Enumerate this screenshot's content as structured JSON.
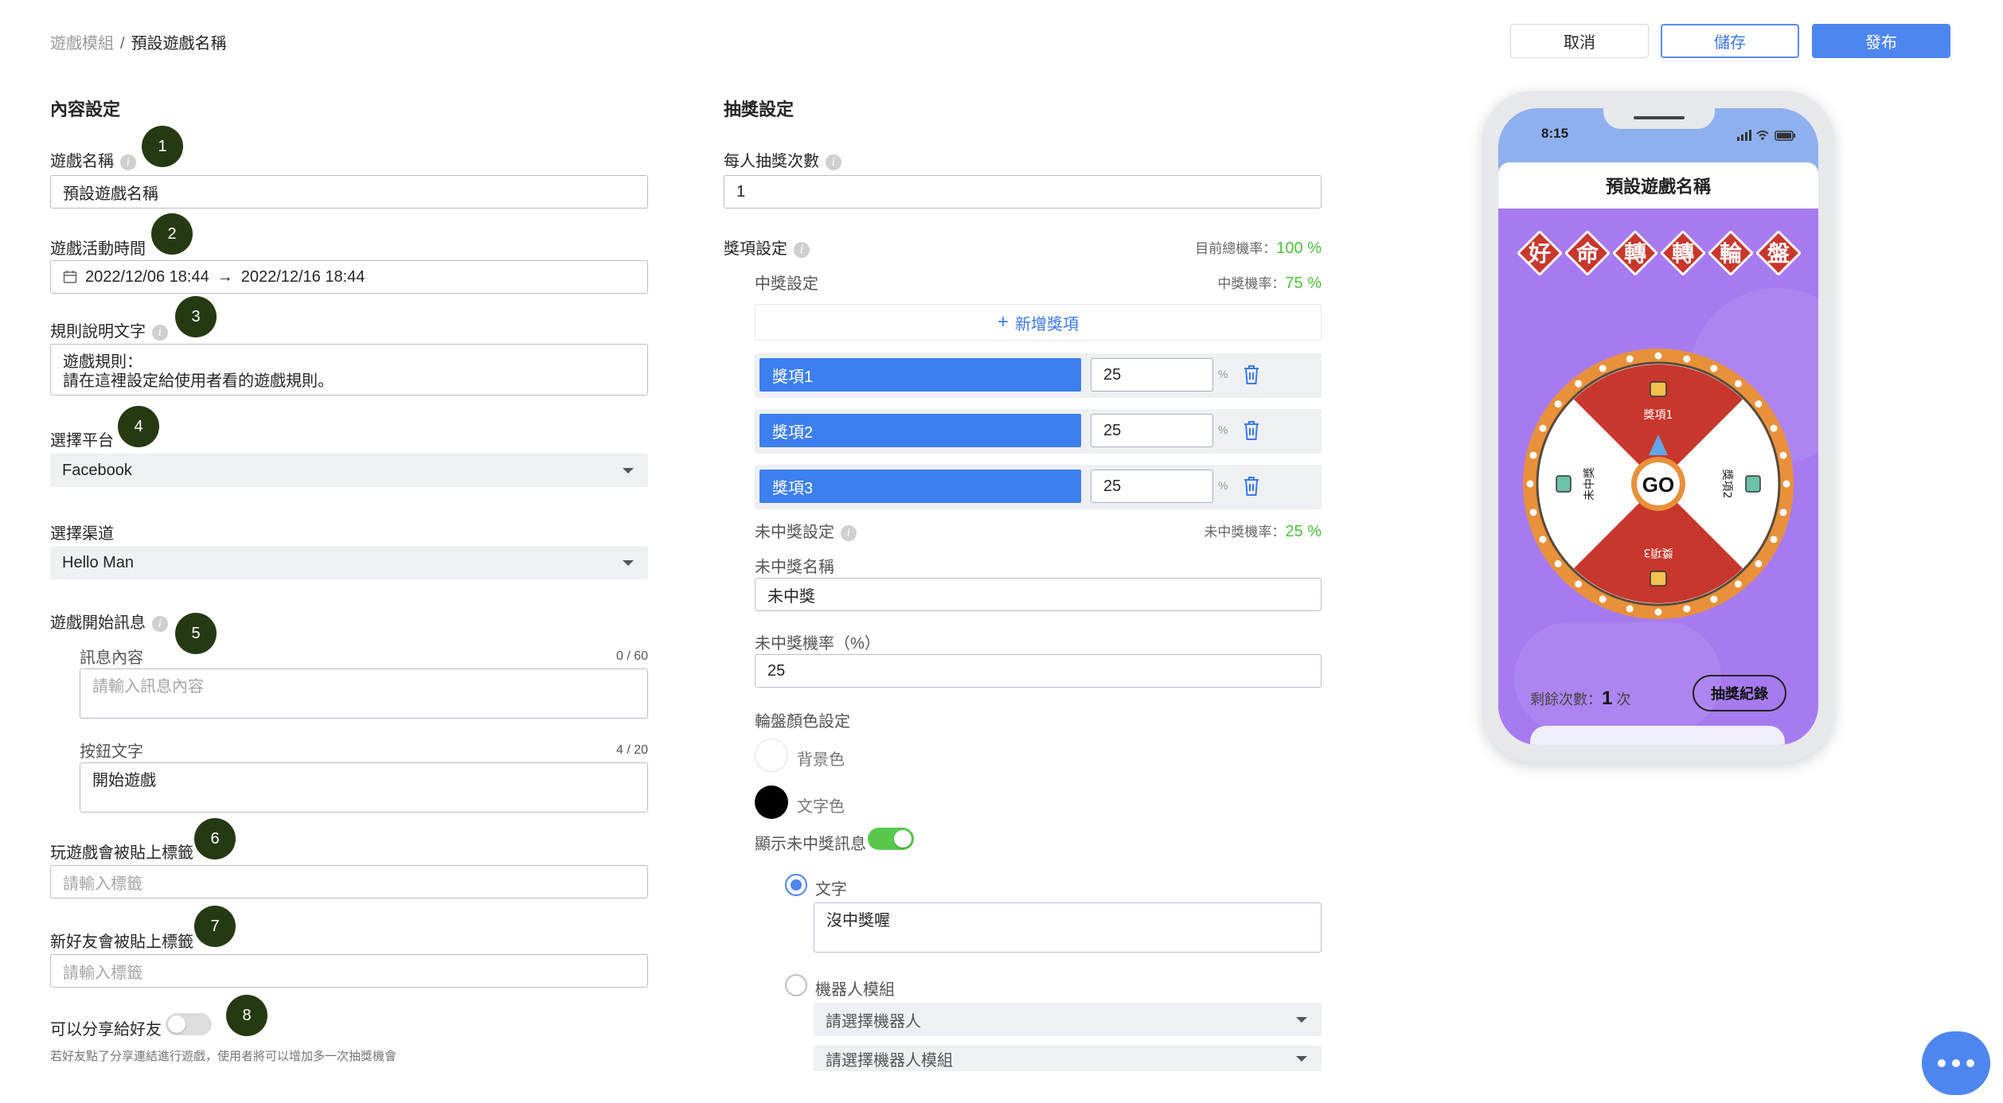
{
  "breadcrumb": {
    "root": "遊戲模組",
    "separator": "/",
    "current": "預設遊戲名稱"
  },
  "actions": {
    "cancel": "取消",
    "save": "儲存",
    "publish": "發布"
  },
  "content_settings": {
    "title": "內容設定",
    "game_name": {
      "label": "遊戲名稱",
      "value": "預設遊戲名稱"
    },
    "game_time": {
      "label": "遊戲活動時間",
      "start": "2022/12/06 18:44",
      "arrow": "→",
      "end": "2022/12/16 18:44"
    },
    "rules": {
      "label": "規則說明文字",
      "line1": "遊戲規則：",
      "line2": "請在這裡設定給使用者看的遊戲規則。"
    },
    "platform": {
      "label": "選擇平台",
      "value": "Facebook"
    },
    "channel": {
      "label": "選擇渠道",
      "value": "Hello Man"
    },
    "start_message": {
      "label": "遊戲開始訊息",
      "content_label": "訊息內容",
      "content_counter": "0 / 60",
      "content_placeholder": "請輸入訊息內容",
      "button_label": "按鈕文字",
      "button_counter": "4 / 20",
      "button_value": "開始遊戲"
    },
    "play_tag": {
      "label": "玩遊戲會被貼上標籤",
      "placeholder": "請輸入標籤"
    },
    "friend_tag": {
      "label": "新好友會被貼上標籤",
      "placeholder": "請輸入標籤"
    },
    "share": {
      "label": "可以分享給好友",
      "enabled": false,
      "note": "若好友點了分享連結進行遊戲，使用者將可以增加多一次抽獎機會"
    },
    "badges": [
      "1",
      "2",
      "3",
      "4",
      "5",
      "6",
      "7",
      "8"
    ]
  },
  "lottery_settings": {
    "title": "抽獎設定",
    "draws_per_person": {
      "label": "每人抽獎次數",
      "value": "1"
    },
    "prize_settings": {
      "label": "獎項設定",
      "total_rate_label": "目前總機率：",
      "total_rate_value": "100 %"
    },
    "win_settings": {
      "label": "中獎設定",
      "rate_label": "中獎機率：",
      "rate_value": "75 %",
      "add_button": "新增獎項",
      "prizes": [
        {
          "name": "獎項1",
          "value": "25",
          "unit": "%"
        },
        {
          "name": "獎項2",
          "value": "25",
          "unit": "%"
        },
        {
          "name": "獎項3",
          "value": "25",
          "unit": "%"
        }
      ]
    },
    "lose_settings": {
      "label": "未中獎設定",
      "rate_label": "未中獎機率：",
      "rate_value": "25 %",
      "name_label": "未中獎名稱",
      "name_value": "未中獎",
      "rate_field_label": "未中獎機率（%）",
      "rate_field_value": "25"
    },
    "wheel_colors": {
      "label": "輪盤顏色設定",
      "background": {
        "label": "背景色",
        "color": "#ffffff"
      },
      "text": {
        "label": "文字色",
        "color": "#000000"
      }
    },
    "show_lose_message": {
      "label": "顯示未中獎訊息",
      "enabled": true,
      "text_option": {
        "label": "文字",
        "checked": true,
        "value": "沒中獎喔"
      },
      "bot_option": {
        "label": "機器人模組",
        "checked": false,
        "bot_placeholder": "請選擇機器人",
        "module_placeholder": "請選擇機器人模組"
      }
    }
  },
  "preview": {
    "time": "8:15",
    "title": "預設遊戲名稱",
    "banner_chars": [
      "好",
      "命",
      "轉",
      "轉",
      "輪",
      "盤"
    ],
    "wheel": {
      "center": "GO",
      "segments": [
        "獎項1",
        "獎項2",
        "獎項3",
        "未中獎"
      ]
    },
    "remaining_label": "剩餘次數：",
    "remaining_value": "1",
    "remaining_unit": "次",
    "record_button": "抽獎紀錄"
  },
  "colors": {
    "accent": "#4e86f0",
    "badge": "#253a13",
    "green": "#4cc23b",
    "wheel_red": "#c8372d",
    "wheel_rim": "#e8903a",
    "phone_bg": "#a77bef"
  }
}
